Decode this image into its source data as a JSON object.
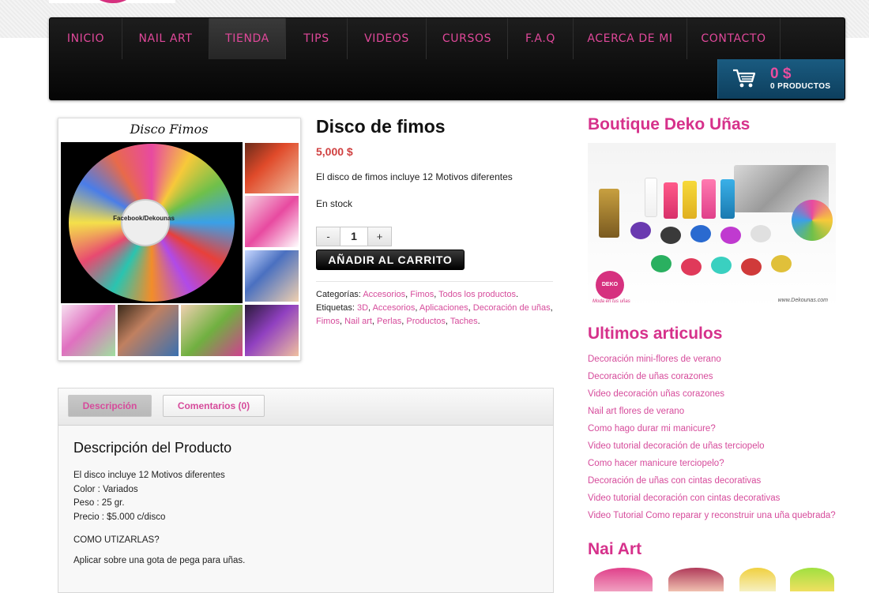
{
  "nav": {
    "items": [
      "INICIO",
      "NAIL ART",
      "TIENDA",
      "TIPS",
      "VIDEOS",
      "CURSOS",
      "F.A.Q",
      "ACERCA DE MI",
      "CONTACTO"
    ],
    "active": "TIENDA"
  },
  "cart": {
    "amount": "0 $",
    "count": "0 PRODUCTOS"
  },
  "product": {
    "image_title": "Disco Fimos",
    "image_watermark": "Facebook/Dekounas",
    "title": "Disco de fimos",
    "price": "5,000 $",
    "short_description": "El disco de fimos incluye 12 Motivos diferentes",
    "stock": "En stock",
    "quantity": "1",
    "qty_minus": "-",
    "qty_plus": "+",
    "add_to_cart": "AÑADIR AL CARRITO",
    "categories_label": "Categorías:",
    "categories": [
      "Accesorios",
      "Fimos",
      "Todos los productos"
    ],
    "tags_label": "Etiquetas:",
    "tags": [
      "3D",
      "Accesorios",
      "Aplicaciones",
      "Decoración de uñas",
      "Fimos",
      "Nail art",
      "Perlas",
      "Productos",
      "Taches"
    ]
  },
  "tabs": {
    "description": "Descripción",
    "reviews": "Comentarios (0)",
    "content_title": "Descripción del Producto",
    "lines": [
      "El disco incluye 12 Motivos diferentes",
      "Color : Variados",
      "Peso : 25 gr.",
      "Precio : $5.000 c/disco"
    ],
    "subheading": "COMO UTIZARLAS?",
    "paragraph": "Aplicar sobre una gota de pega para uñas."
  },
  "sidebar": {
    "boutique_title": "Boutique Deko Uñas",
    "boutique_brand": "DEKO Uñas",
    "boutique_slogan": "Moda en tus uñas",
    "boutique_url": "www.Dekounas.com",
    "articles_title": "Ultimos articulos",
    "articles": [
      "Decoración mini-flores de verano",
      "Decoración de uñas corazones",
      "Video decoración uñas corazones",
      "Nail art flores de verano",
      "Como hago durar mi manicure?",
      "Video tutorial decoración de uñas terciopelo",
      "Como hacer manicure terciopelo?",
      "Decoración de uñas con cintas decorativas",
      "Video tutorial decoración con cintas decorativas",
      "Video Tutorial Como reparar y reconstruir una uña quebrada?"
    ],
    "nailart_title": "Nai Art"
  },
  "colors": {
    "brand_pink": "#d6318b",
    "link_pink": "#d64b9b",
    "price_red": "#d04040",
    "cart_blue": "#0d3f5e"
  },
  "icons": [
    "cart-icon"
  ]
}
